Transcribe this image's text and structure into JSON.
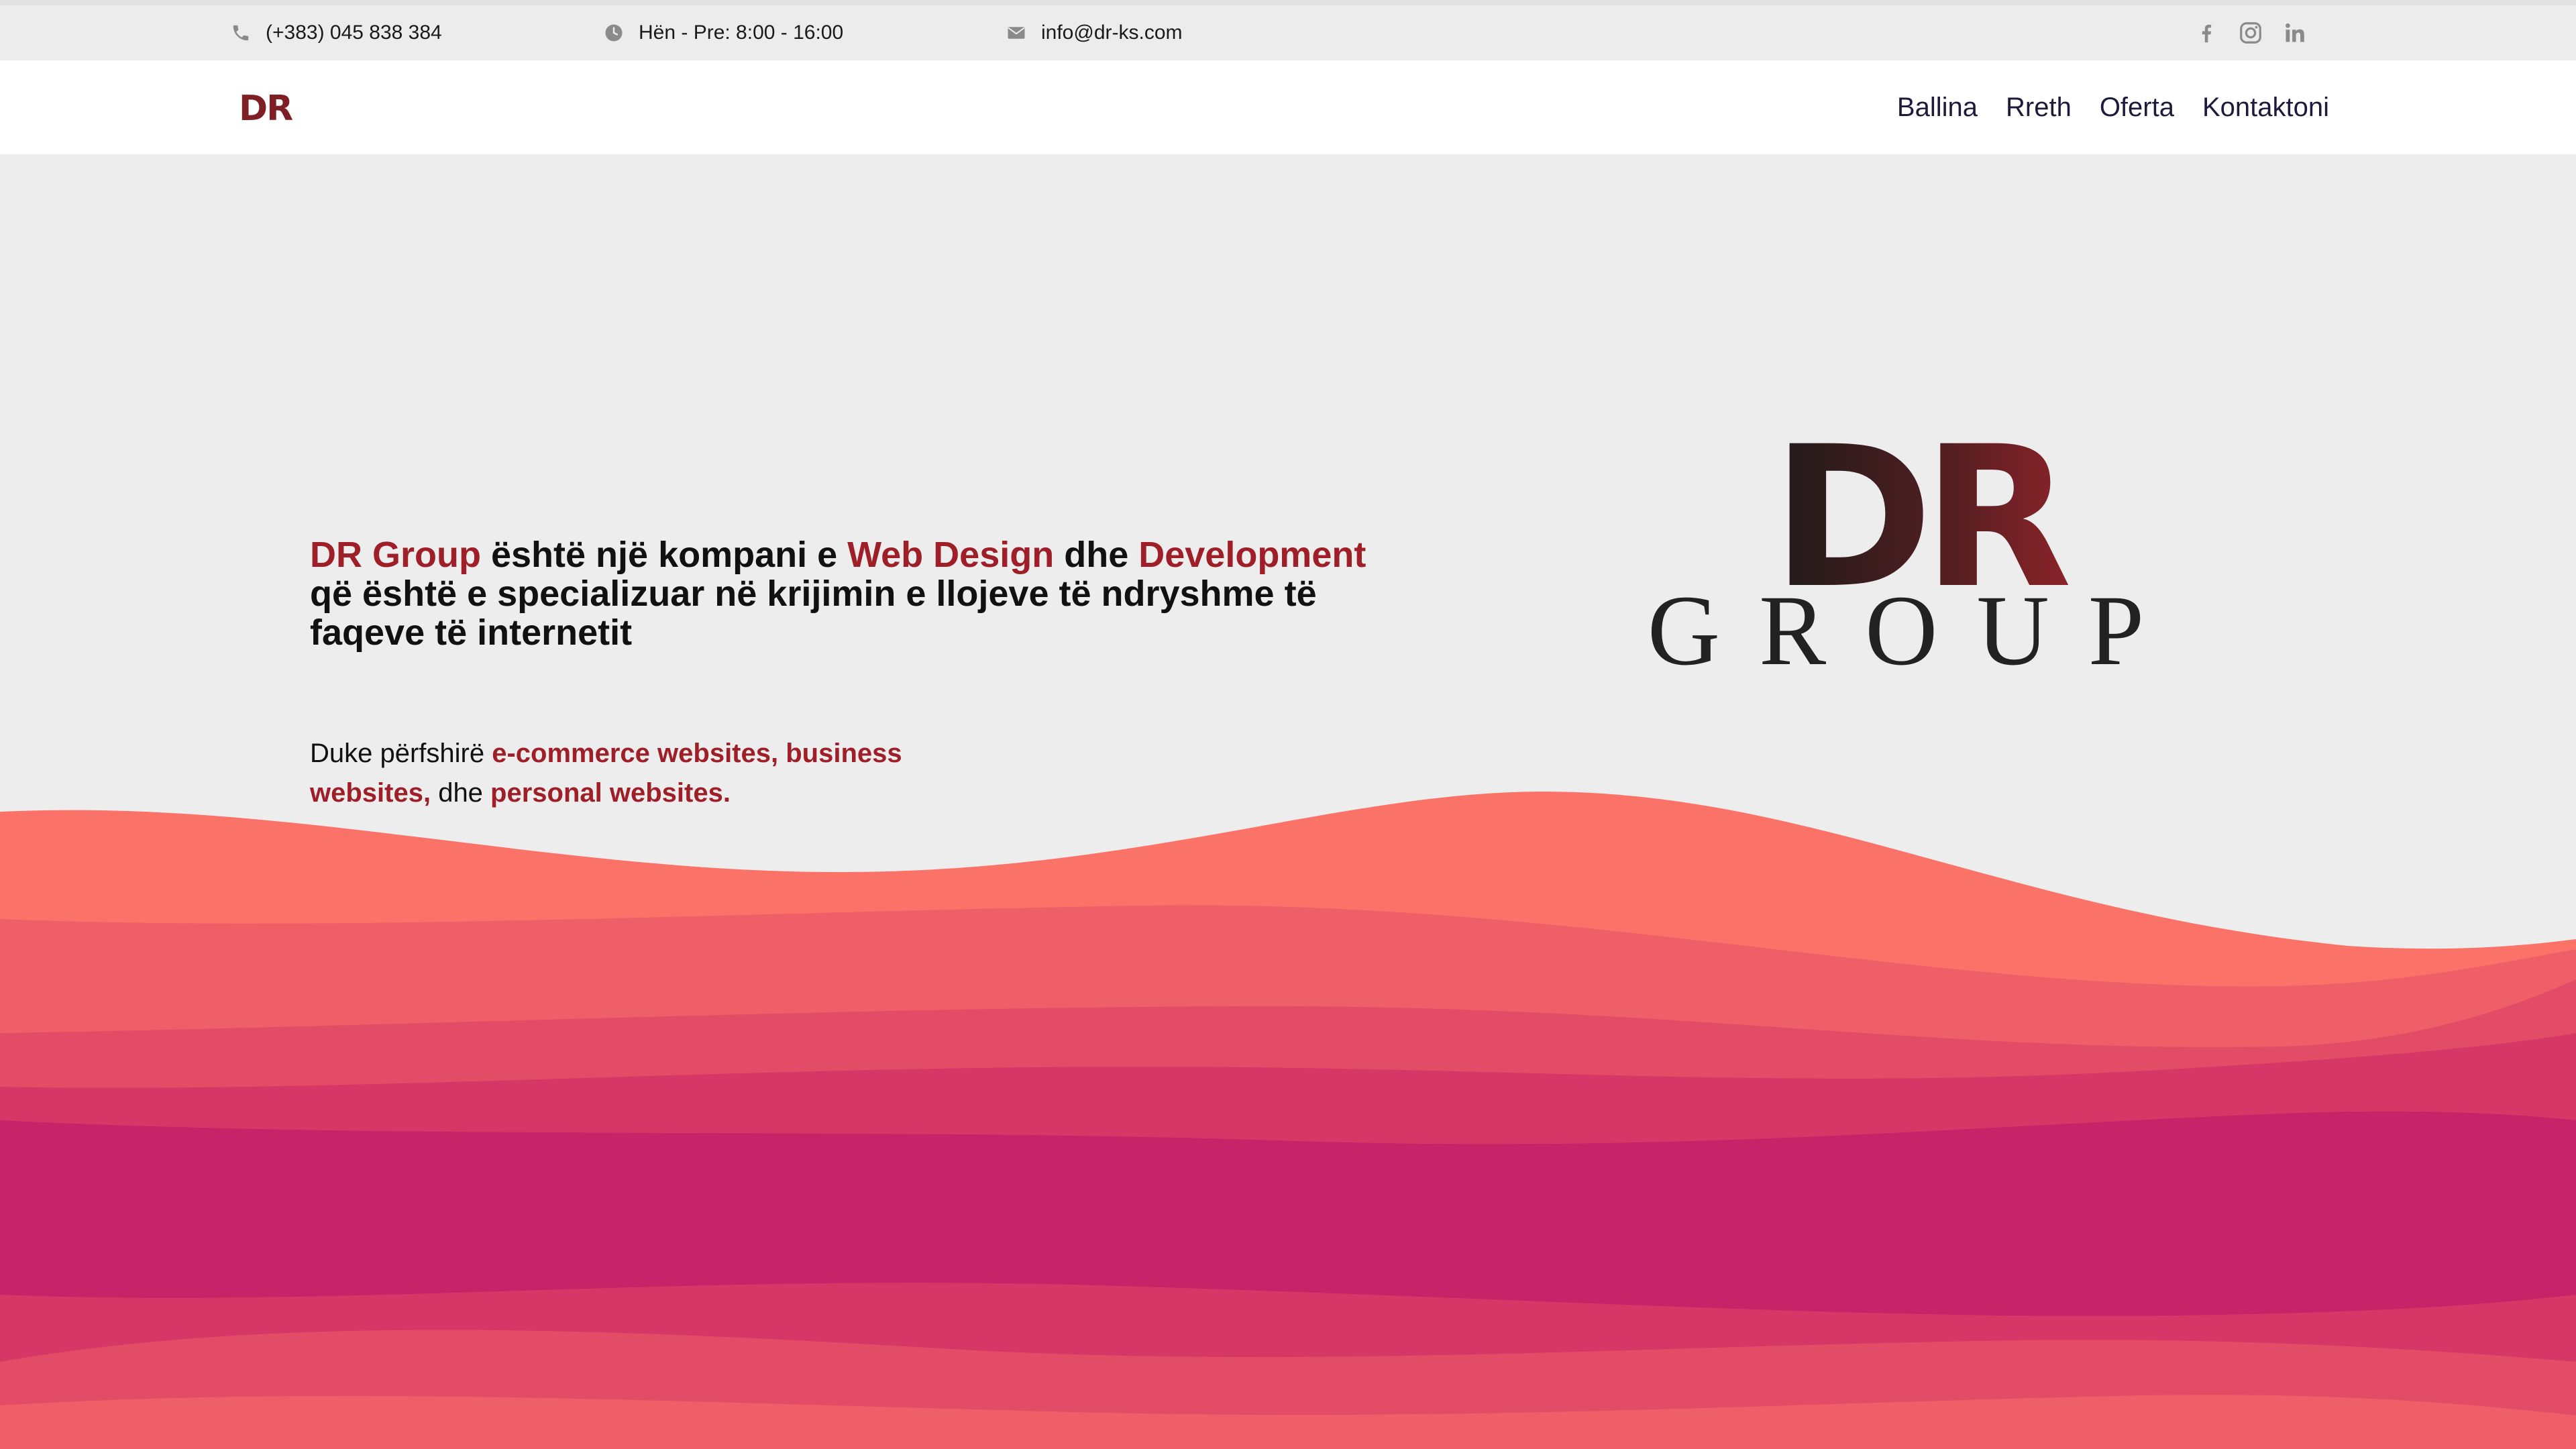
{
  "topbar": {
    "phone": "(+383) 045 838 384",
    "hours": "Hën - Pre: 8:00 - 16:00",
    "email": "info@dr-ks.com",
    "social": [
      "facebook-icon",
      "instagram-icon",
      "linkedin-icon"
    ]
  },
  "navbar": {
    "logo": "DR",
    "links": [
      "Ballina",
      "Rreth",
      "Oferta",
      "Kontaktoni"
    ]
  },
  "hero": {
    "title_brand": "DR Group",
    "title_part1": " është një kompani e ",
    "title_highlight1": "Web Design",
    "title_part2": " dhe ",
    "title_highlight2": "Development",
    "title_part3": " që është e specializuar në krijimin e llojeve të ndryshme të faqeve të internetit",
    "sub_prefix": "Duke përfshirë ",
    "sub_highlight1": "e-commerce websites, business websites,",
    "sub_middle": " dhe ",
    "sub_highlight2": "personal websites."
  },
  "logo": {
    "mark": "DR",
    "word": "GROUP"
  },
  "colors": {
    "accent": "#9e1f28",
    "background": "#ededed",
    "wave_colors": [
      "#fa7268",
      "#ef5f67",
      "#e34c67",
      "#d53867",
      "#c62368"
    ]
  }
}
